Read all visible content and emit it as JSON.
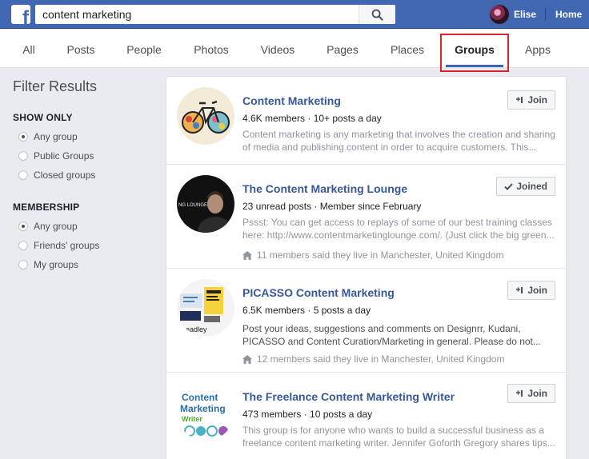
{
  "header": {
    "search_value": "content marketing",
    "user_name": "Elise",
    "home_label": "Home",
    "brand_color": "#4267b2"
  },
  "tabs": [
    "All",
    "Posts",
    "People",
    "Photos",
    "Videos",
    "Pages",
    "Places",
    "Groups",
    "Apps"
  ],
  "active_tab": "Groups",
  "sidebar": {
    "title": "Filter Results",
    "show_only": {
      "title": "SHOW ONLY",
      "options": [
        "Any group",
        "Public Groups",
        "Closed groups"
      ],
      "selected": "Any group"
    },
    "membership": {
      "title": "MEMBERSHIP",
      "options": [
        "Any group",
        "Friends' groups",
        "My groups"
      ],
      "selected": "Any group"
    }
  },
  "results": [
    {
      "title": "Content Marketing",
      "meta": "4.6K members · 10+ posts a day",
      "desc": [
        "Content marketing is any marketing that involves the creation and sharing",
        "of media and publishing content in order to acquire customers. This..."
      ],
      "button": "Join",
      "button_icon": "add-member-icon"
    },
    {
      "title": "The Content Marketing Lounge",
      "meta": "23 unread posts · Member since February",
      "desc": [
        "Pssst: You can get access to replays of some of our best training classes",
        "here: http://www.contentmarketinglounge.com/. (Just click the big green..."
      ],
      "location": "11 members said they live in Manchester, United Kingdom",
      "button": "Joined",
      "button_icon": "check-icon",
      "thumb_text": "NG LOUNGE"
    },
    {
      "title": "PICASSO Content Marketing",
      "meta": "6.5K members · 5 posts a day",
      "desc": [
        "Post your ideas, suggestions and comments on Designrr, Kudani,",
        "PICASSO and Content Curation/Marketing in general. Please do not..."
      ],
      "location": "12 members said they live in Manchester, United Kingdom",
      "button": "Join",
      "button_icon": "add-member-icon",
      "thumb_text": "headley"
    },
    {
      "title": "The Freelance Content Marketing Writer",
      "meta": "473 members · 10 posts a day",
      "desc": [
        "This group is for anyone who wants to build a successful business as a",
        "freelance content marketing writer. Jennifer Goforth Gregory shares tips..."
      ],
      "button": "Join",
      "button_icon": "add-member-icon",
      "thumb_text": [
        "Content",
        "Marketing",
        "Writer"
      ]
    }
  ]
}
